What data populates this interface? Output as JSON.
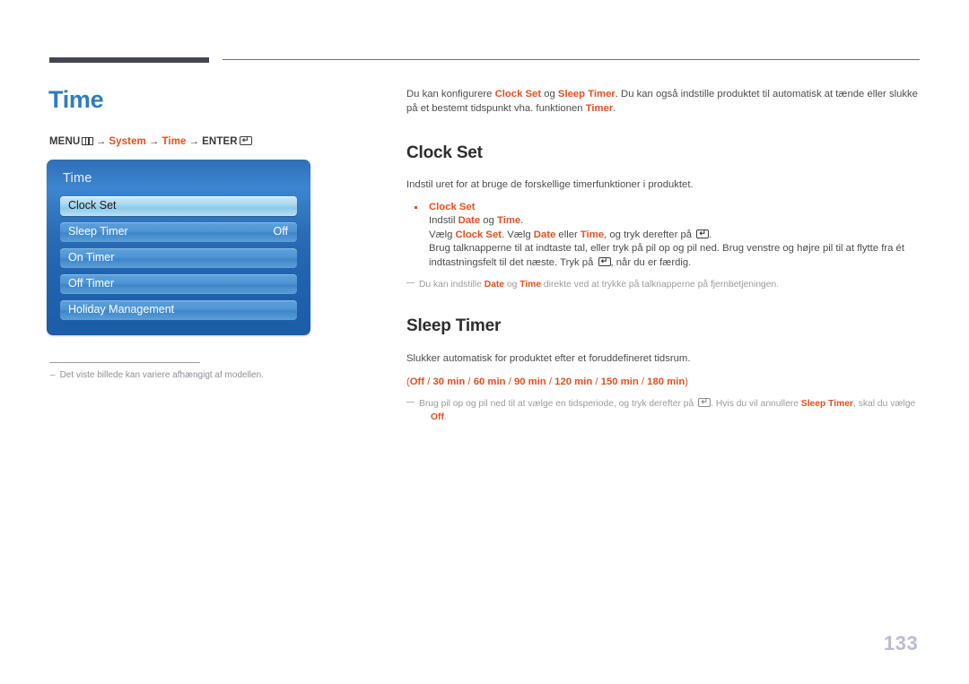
{
  "page": {
    "title": "Time",
    "number": "133"
  },
  "breadcrumb": {
    "menu_label": "MENU",
    "menu_icon": "menu-grid-icon",
    "arrow": "→",
    "item_system": "System",
    "item_time": "Time",
    "enter_label": "ENTER",
    "enter_icon": "enter-key-icon",
    "enter_glyph": "↵"
  },
  "osd": {
    "title": "Time",
    "items": [
      {
        "label": "Clock Set",
        "value": "",
        "selected": true
      },
      {
        "label": "Sleep Timer",
        "value": "Off",
        "selected": false
      },
      {
        "label": "On Timer",
        "value": "",
        "selected": false
      },
      {
        "label": "Off Timer",
        "value": "",
        "selected": false
      },
      {
        "label": "Holiday Management",
        "value": "",
        "selected": false
      }
    ]
  },
  "left_note": {
    "dash": "–",
    "text": "Det viste billede kan variere afhængigt af modellen."
  },
  "intro": {
    "part1": "Du kan konfigurere ",
    "accent1": "Clock Set",
    "part2": " og ",
    "accent2": "Sleep Timer",
    "part3": ". Du kan også indstille produktet til automatisk at tænde eller slukke på et bestemt tidspunkt vha. funktionen ",
    "accent3": "Timer",
    "part4": "."
  },
  "clock_set": {
    "heading": "Clock Set",
    "description": "Indstil uret for at bruge de forskellige timerfunktioner i produktet.",
    "bullet_title": "Clock Set",
    "line1_part1": "Indstil ",
    "line1_accent1": "Date",
    "line1_part2": " og ",
    "line1_accent2": "Time",
    "line1_part3": ".",
    "line2_part1": "Vælg ",
    "line2_accent1": "Clock Set",
    "line2_part2": ". Vælg ",
    "line2_accent2": "Date",
    "line2_part3": " eller ",
    "line2_accent3": "Time",
    "line2_part4": ", og tryk derefter på ",
    "line2_part5": ".",
    "line3_part1": "Brug talknapperne til at indtaste tal, eller tryk på pil op og pil ned. Brug venstre og højre pil til at flytte fra ét indtastningsfelt til det næste. Tryk på ",
    "line3_part2": ", når du er færdig.",
    "note_part1": "Du kan indstille ",
    "note_accent1": "Date",
    "note_part2": " og ",
    "note_accent2": "Time",
    "note_part3": " direkte ved at trykke på talknapperne på fjernbetjeningen."
  },
  "sleep_timer": {
    "heading": "Sleep Timer",
    "description": "Slukker automatisk for produktet efter et foruddefineret tidsrum.",
    "options_open": "(",
    "options": [
      "Off",
      "30 min",
      "60 min",
      "90 min",
      "120 min",
      "150 min",
      "180 min"
    ],
    "options_separator": " / ",
    "options_close": ")",
    "note_part1": "Brug pil op og pil ned til at vælge en tidsperiode, og tryk derefter på ",
    "note_part2": ". Hvis du vil annullere ",
    "note_accent1": "Sleep Timer",
    "note_part3": ", skal du vælge",
    "note_accent2": "Off",
    "note_part4": "."
  },
  "colors": {
    "accent": "#e2501e",
    "title_blue": "#2f7cc0",
    "heading": "#2d2d2d",
    "body": "#4c4c4c",
    "note": "#9b9b9b",
    "page_number": "#b9bcd0",
    "osd_blue": "#1f62ad"
  }
}
